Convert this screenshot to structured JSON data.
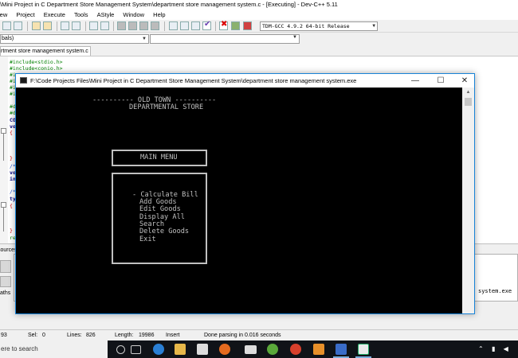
{
  "ide": {
    "title": "\\Mini Project in C Department Store Management System\\department store management system.c - [Executing] - Dev-C++ 5.11",
    "menu": [
      "iew",
      "Project",
      "Execute",
      "Tools",
      "AStyle",
      "Window",
      "Help"
    ],
    "compiler": "TDM-GCC 4.9.2 64-bit Release",
    "scope": "bals)",
    "file_tab": "rtment store management system.c",
    "code_lines": [
      "#include<stdio.h>",
      "#include<conio.h>",
      "#i",
      "#i",
      "#i",
      "#i",
      "#d",
      "#d",
      "CO",
      "vo",
      "{",
      "}",
      "/*",
      "vo",
      "in",
      "/*",
      "ty",
      "{",
      "}",
      "re"
    ],
    "bottom_tab": "sources",
    "bottom_left_label": "aths",
    "right_output": "system.exe",
    "status": {
      "col": "93",
      "sel_label": "Sel:",
      "sel": "0",
      "lines_label": "Lines:",
      "lines": "826",
      "length_label": "Length:",
      "length": "19986",
      "mode": "Insert",
      "message": "Done parsing in 0.016 seconds"
    }
  },
  "console": {
    "title": "F:\\Code Projects Files\\Mini Project in C Department Store Management System\\department store management system.exe",
    "controls": {
      "minimize": "—",
      "maximize": "☐",
      "close": "✕"
    },
    "header_line1": "---------- OLD TOWN ----------",
    "header_line2": "DEPARTMENTAL STORE",
    "main_menu": "MAIN MENU",
    "selected_item": "- Calculate Bill",
    "items": [
      "Add Goods",
      "Edit Goods",
      "Display All",
      "Search",
      "Delete Goods",
      "Exit"
    ]
  },
  "taskbar": {
    "search": "ere to search"
  }
}
